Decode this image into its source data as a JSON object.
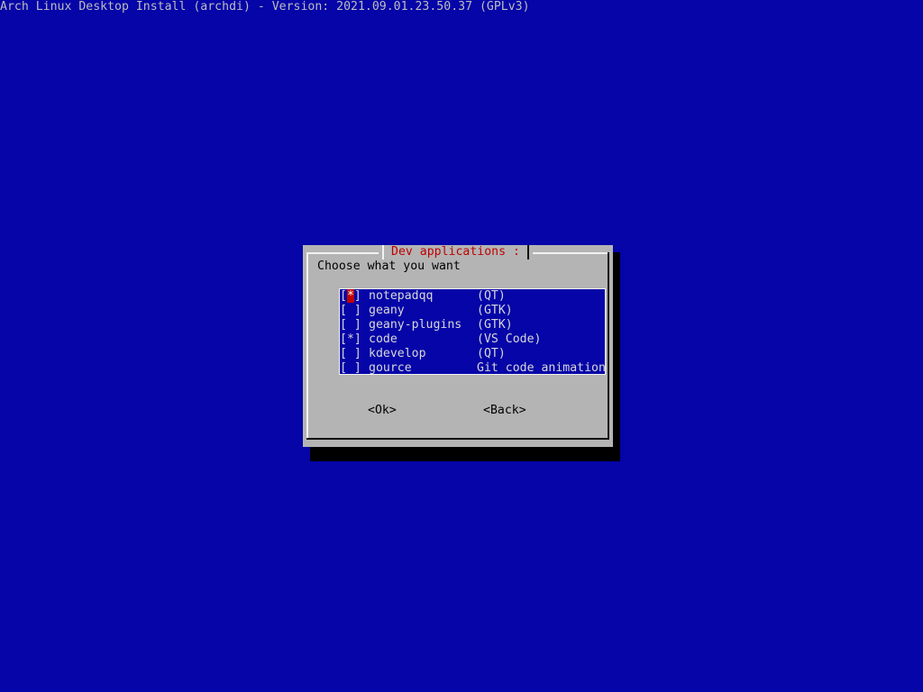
{
  "backtitle": "Arch Linux Desktop Install (archdi) - Version: 2021.09.01.23.50.37 (GPLv3)",
  "dialog": {
    "title": "Dev applications :",
    "prompt": "Choose what you want",
    "items": [
      {
        "checkbox": "[*]",
        "name": "notepadqq",
        "desc": "(QT)",
        "checked": true
      },
      {
        "checkbox": "[ ]",
        "name": "geany",
        "desc": "(GTK)",
        "checked": false
      },
      {
        "checkbox": "[ ]",
        "name": "geany-plugins",
        "desc": "(GTK)",
        "checked": false
      },
      {
        "checkbox": "[*]",
        "name": "code",
        "desc": "(VS Code)",
        "checked": true
      },
      {
        "checkbox": "[ ]",
        "name": "kdevelop",
        "desc": "(QT)",
        "checked": false
      },
      {
        "checkbox": "[ ]",
        "name": "gource",
        "desc": "Git code animation",
        "checked": false
      }
    ],
    "buttons": {
      "ok": "<Ok>",
      "back": "<Back>"
    }
  },
  "colors": {
    "background": "#0505a8",
    "dialog": "#b4b4b4",
    "title": "#c00000",
    "highlight": "#c00000"
  }
}
